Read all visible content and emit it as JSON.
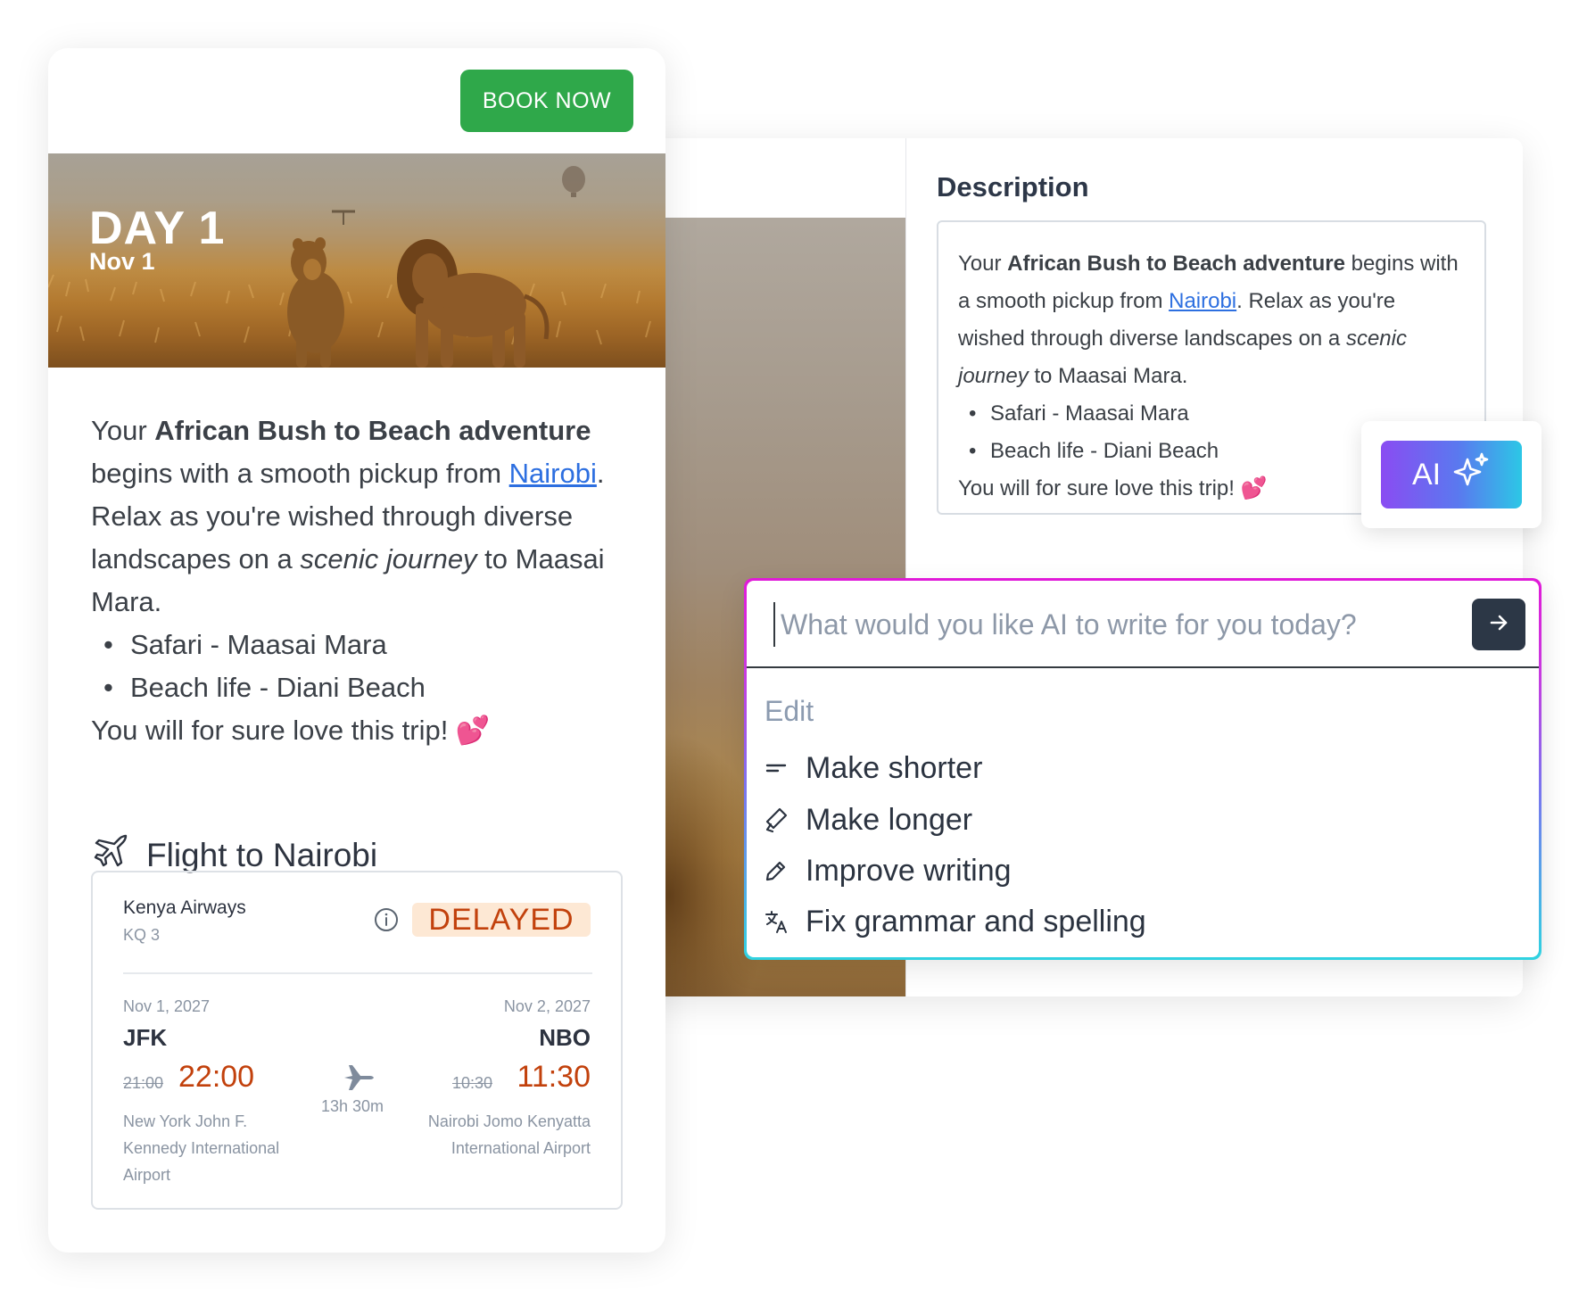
{
  "card": {
    "book_label": "BOOK NOW",
    "hero": {
      "day": "DAY 1",
      "date": "Nov 1"
    },
    "text": {
      "intro": "Your ",
      "bold": "African Bush to Beach adventure",
      "after_bold": " begins with a smooth pickup from ",
      "link": "Nairobi",
      "after_link": ". Relax as you're wished through diverse landscapes on a ",
      "italic": "scenic journey",
      "after_italic": " to Maasai Mara.",
      "bullets": [
        "Safari - Maasai Mara",
        "Beach life - Diani Beach"
      ],
      "closing": "You will for sure love this trip! 💕"
    },
    "flight_heading": "Flight to Nairobi",
    "flight": {
      "airline": "Kenya Airways",
      "flight_no": "KQ 3",
      "status": "DELAYED",
      "status_color": "#c2410c",
      "duration": "13h 30m",
      "origin": {
        "date": "Nov 1, 2027",
        "code": "JFK",
        "old_time": "21:00",
        "new_time": "22:00",
        "airport": "New York John F. Kennedy International Airport"
      },
      "destination": {
        "date": "Nov 2, 2027",
        "code": "NBO",
        "old_time": "10:30",
        "new_time": "11:30",
        "airport": "Nairobi Jomo Kenyatta International Airport"
      }
    }
  },
  "editor": {
    "description_label": "Description",
    "text": {
      "intro": "Your ",
      "bold": "African Bush to Beach adventure",
      "after_bold": " begins with a smooth pickup from ",
      "link": "Nairobi",
      "after_link": ". Relax as you're wished through diverse landscapes on a ",
      "italic": "scenic journey",
      "after_italic": " to Maasai Mara.",
      "bullets": [
        "Safari - Maasai Mara",
        "Beach life - Diani Beach"
      ],
      "closing": "You will for sure love this trip! 💕"
    },
    "ai_button_label": "AI"
  },
  "ai_panel": {
    "placeholder": "What would you like AI to write for you today?",
    "section_label": "Edit",
    "items": [
      {
        "label": "Make shorter",
        "icon": "lines-icon"
      },
      {
        "label": "Make longer",
        "icon": "magic-wand-icon"
      },
      {
        "label": "Improve writing",
        "icon": "pencil-icon"
      },
      {
        "label": "Fix grammar and spelling",
        "icon": "translate-icon"
      }
    ]
  },
  "colors": {
    "book_button": "#2fa84a",
    "link": "#2d6fe0",
    "ai_gradient_start": "#8a4cf2",
    "ai_gradient_end": "#2cc7e6",
    "panel_border_top": "#e11ad8",
    "panel_border_bottom": "#2fd3e1"
  }
}
